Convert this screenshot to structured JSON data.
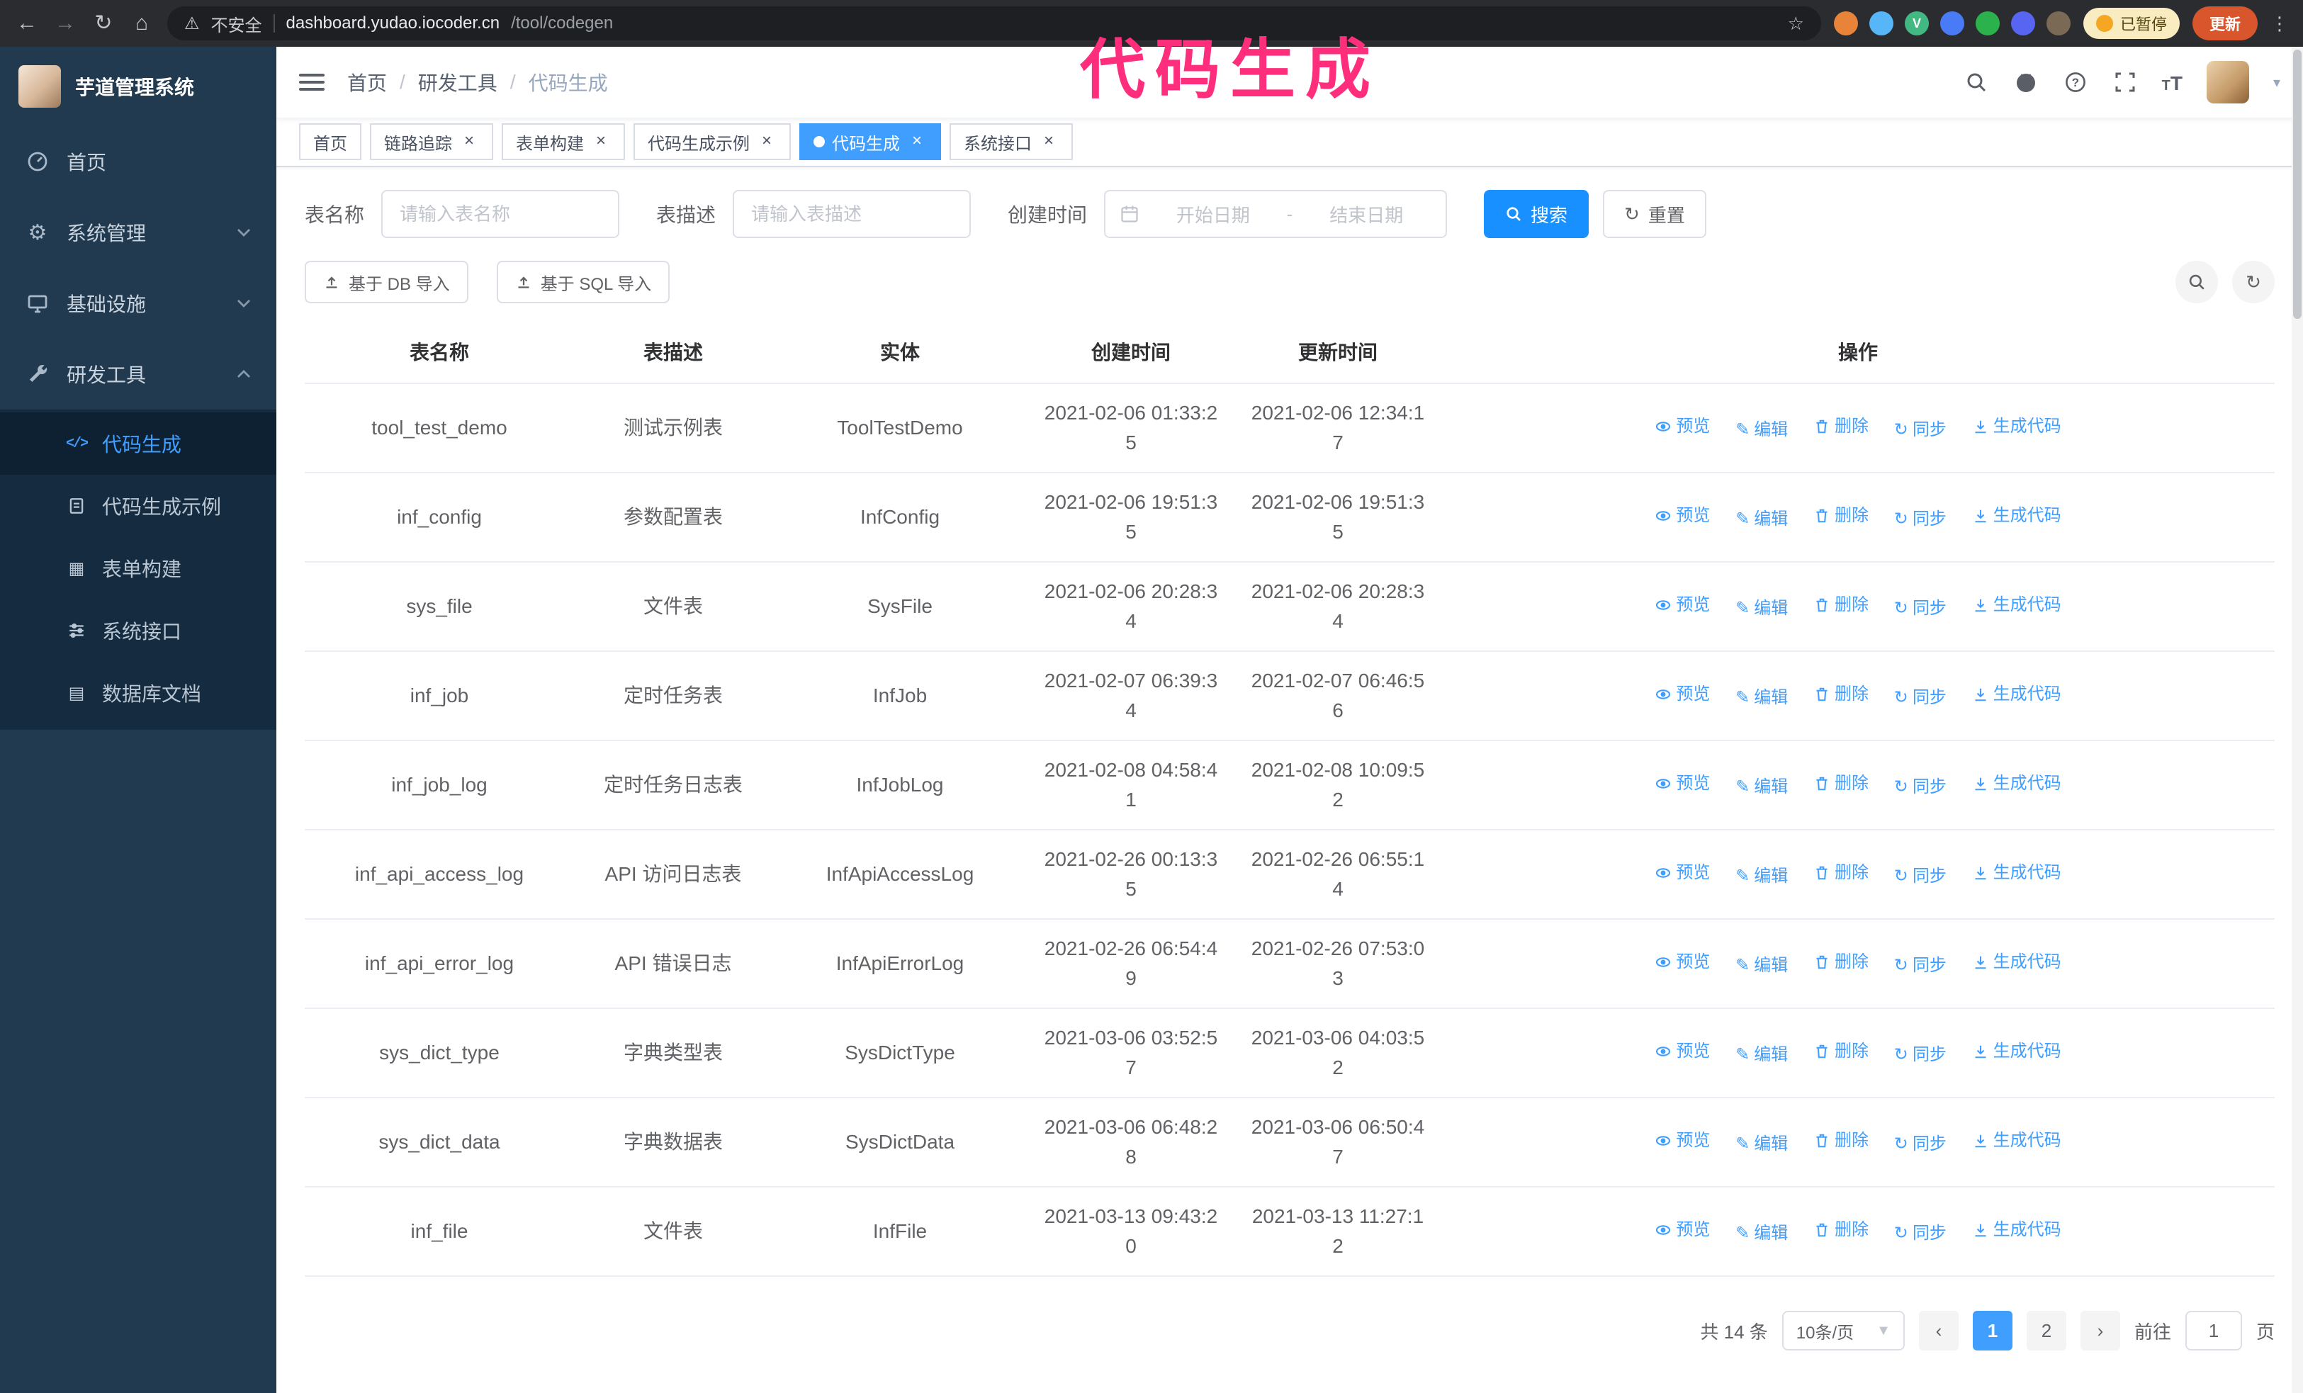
{
  "colors": {
    "accent": "#409eff",
    "primary_button": "#1890ff",
    "annotation": "#ff2e7d",
    "sidebar_bg": "#223a50",
    "submenu_bg": "#142b40",
    "chrome_bg": "#2a2c30",
    "link": "#409eff"
  },
  "browser": {
    "security_label": "不安全",
    "url_domain": "dashboard.yudao.iocoder.cn",
    "url_path": "/tool/codegen",
    "paused_badge": "已暂停",
    "update_button": "更新",
    "extensions": [
      {
        "name": "extension-orange",
        "color": "#e8833a"
      },
      {
        "name": "extension-blue-drop",
        "color": "#56b6f7"
      },
      {
        "name": "extension-vue",
        "color": "#42b983"
      },
      {
        "name": "extension-blue-grid",
        "color": "#4a7bf7"
      },
      {
        "name": "extension-green",
        "color": "#2bb24c"
      },
      {
        "name": "extension-purple",
        "color": "#5865f2"
      },
      {
        "name": "extension-brown",
        "color": "#7a6a55"
      }
    ]
  },
  "annotation": {
    "text": "代码生成"
  },
  "sidebar": {
    "logo_title": "芋道管理系统",
    "items": {
      "home": "首页",
      "system": "系统管理",
      "infra": "基础设施",
      "devtools": "研发工具"
    },
    "sub_items": [
      {
        "label": "代码生成",
        "active": true
      },
      {
        "label": "代码生成示例",
        "active": false
      },
      {
        "label": "表单构建",
        "active": false
      },
      {
        "label": "系统接口",
        "active": false
      },
      {
        "label": "数据库文档",
        "active": false
      }
    ]
  },
  "header": {
    "breadcrumb": [
      "首页",
      "研发工具",
      "代码生成"
    ],
    "icons": [
      "search",
      "github",
      "help",
      "fullscreen",
      "font-size",
      "avatar"
    ]
  },
  "tabs": [
    {
      "label": "首页",
      "closable": false,
      "active": false
    },
    {
      "label": "链路追踪",
      "closable": true,
      "active": false
    },
    {
      "label": "表单构建",
      "closable": true,
      "active": false
    },
    {
      "label": "代码生成示例",
      "closable": true,
      "active": false
    },
    {
      "label": "代码生成",
      "closable": true,
      "active": true
    },
    {
      "label": "系统接口",
      "closable": true,
      "active": false
    }
  ],
  "filters": {
    "name_label": "表名称",
    "name_placeholder": "请输入表名称",
    "desc_label": "表描述",
    "desc_placeholder": "请输入表描述",
    "date_label": "创建时间",
    "date_start_placeholder": "开始日期",
    "date_separator": "-",
    "date_end_placeholder": "结束日期",
    "search_button": "搜索",
    "reset_button": "重置"
  },
  "toolbar": {
    "import_db": "基于 DB 导入",
    "import_sql": "基于 SQL 导入"
  },
  "table": {
    "headers": [
      "表名称",
      "表描述",
      "实体",
      "创建时间",
      "更新时间",
      "操作"
    ],
    "actions": {
      "preview": "预览",
      "edit": "编辑",
      "delete": "删除",
      "sync": "同步",
      "generate": "生成代码"
    },
    "action_icons": {
      "preview": "eye",
      "edit": "pencil",
      "delete": "trash",
      "sync": "refresh",
      "generate": "download"
    },
    "rows": [
      {
        "name": "tool_test_demo",
        "desc": "测试示例表",
        "entity": "ToolTestDemo",
        "created": "2021-02-06 01:33:25",
        "updated": "2021-02-06 12:34:17"
      },
      {
        "name": "inf_config",
        "desc": "参数配置表",
        "entity": "InfConfig",
        "created": "2021-02-06 19:51:35",
        "updated": "2021-02-06 19:51:35"
      },
      {
        "name": "sys_file",
        "desc": "文件表",
        "entity": "SysFile",
        "created": "2021-02-06 20:28:34",
        "updated": "2021-02-06 20:28:34"
      },
      {
        "name": "inf_job",
        "desc": "定时任务表",
        "entity": "InfJob",
        "created": "2021-02-07 06:39:34",
        "updated": "2021-02-07 06:46:56"
      },
      {
        "name": "inf_job_log",
        "desc": "定时任务日志表",
        "entity": "InfJobLog",
        "created": "2021-02-08 04:58:41",
        "updated": "2021-02-08 10:09:52"
      },
      {
        "name": "inf_api_access_log",
        "desc": "API 访问日志表",
        "entity": "InfApiAccessLog",
        "created": "2021-02-26 00:13:35",
        "updated": "2021-02-26 06:55:14"
      },
      {
        "name": "inf_api_error_log",
        "desc": "API 错误日志",
        "entity": "InfApiErrorLog",
        "created": "2021-02-26 06:54:49",
        "updated": "2021-02-26 07:53:03"
      },
      {
        "name": "sys_dict_type",
        "desc": "字典类型表",
        "entity": "SysDictType",
        "created": "2021-03-06 03:52:57",
        "updated": "2021-03-06 04:03:52"
      },
      {
        "name": "sys_dict_data",
        "desc": "字典数据表",
        "entity": "SysDictData",
        "created": "2021-03-06 06:48:28",
        "updated": "2021-03-06 06:50:47"
      },
      {
        "name": "inf_file",
        "desc": "文件表",
        "entity": "InfFile",
        "created": "2021-03-13 09:43:20",
        "updated": "2021-03-13 11:27:12"
      }
    ]
  },
  "pagination": {
    "total": "共 14 条",
    "page_size": "10条/页",
    "prev": "‹",
    "pages": [
      "1",
      "2"
    ],
    "active_page": "1",
    "next": "›",
    "goto_label": "前往",
    "goto_value": "1",
    "goto_suffix": "页"
  }
}
